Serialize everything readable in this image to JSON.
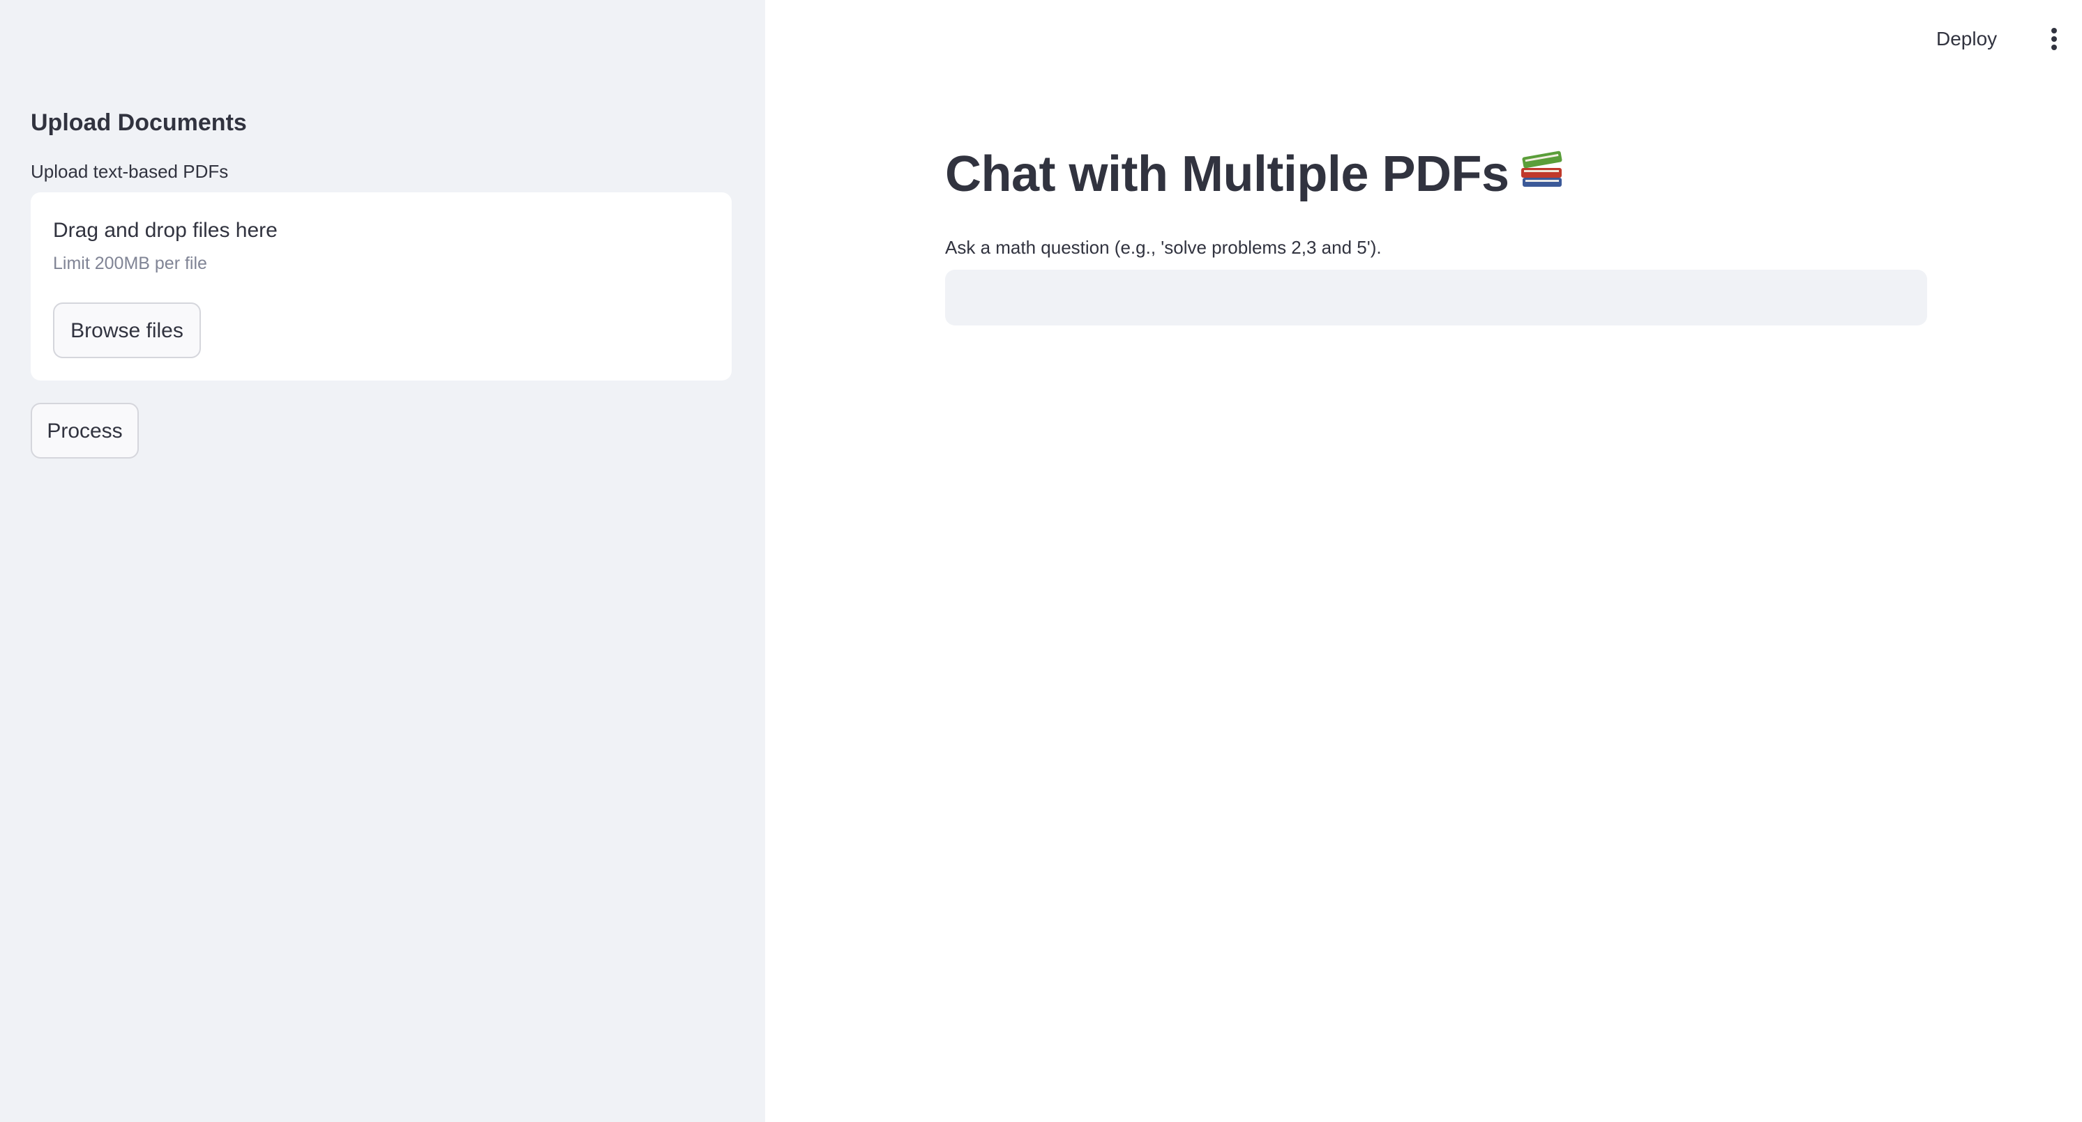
{
  "sidebar": {
    "heading": "Upload Documents",
    "uploader": {
      "label": "Upload text-based PDFs",
      "dropzone_title": "Drag and drop files here",
      "limit_text": "Limit 200MB per file",
      "browse_label": "Browse files"
    },
    "process_label": "Process"
  },
  "header": {
    "deploy_label": "Deploy",
    "menu_icon": "vertical-ellipsis-icon"
  },
  "main": {
    "title": "Chat with Multiple PDFs",
    "title_icon": "books-icon",
    "question_label": "Ask a math question (e.g., 'solve problems 2,3 and 5').",
    "question_value": ""
  },
  "colors": {
    "sidebar_bg": "#f0f2f6",
    "text": "#31333f",
    "muted_text": "#808495",
    "input_bg": "#f0f2f6"
  }
}
